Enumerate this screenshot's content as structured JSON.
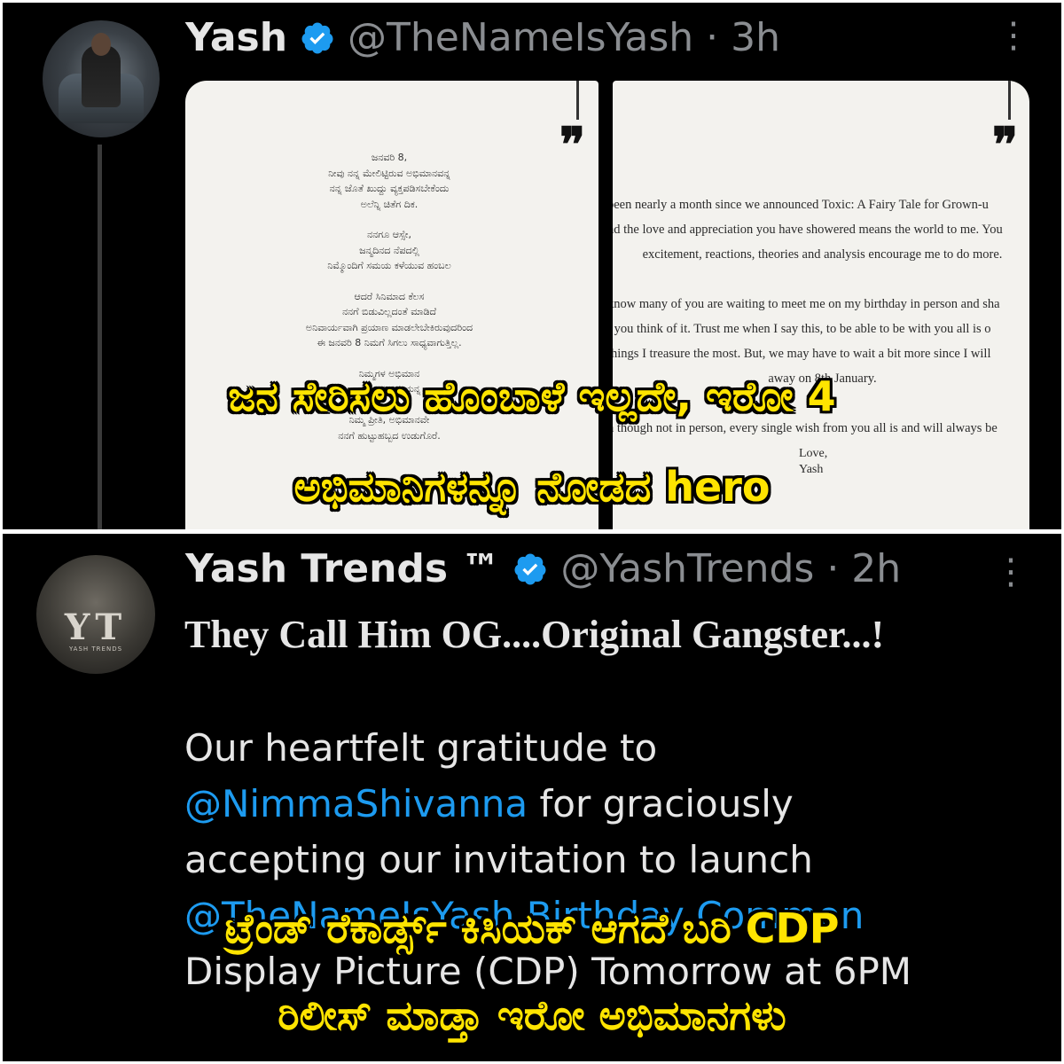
{
  "tweet1": {
    "name": "Yash",
    "handle": "@TheNameIsYash · 3h",
    "more": "⋮",
    "letter_left": [
      "ಜನವರಿ 8,",
      "ನೀವು ನನ್ನ ಮೇಲಿಟ್ಟಿರುವ ಅಭಿಮಾನವನ್ನ",
      "ನನ್ನ ಜೊತೆ ಖುದ್ದು ವ್ಯಕ್ತಪಡಿಸಬೇಕೆಂದು",
      "ಅಲೆನ್ನಿ ಚಿತೆಗ ದಿಕ.",
      "ನನಗೂ ಆಸ್ಸೇ,",
      "ಜನ್ಮದಿನದ ನೆಪದಲ್ಲಿ",
      "ನಿಮ್ಮೊಂದಿಗೆ ಸಮಯ ಕಳೆಯುವ ಹಂಬಲ",
      "ಆದರೆ ಸಿನಿಮಾದ ಕೆಲಸ",
      "ನನಗೆ ಬಿಡುವಿಲ್ಲದಂತೆ ಮಾಡಿದೆ",
      "ಅನಿವಾರ್ಯವಾಗಿ ಪ್ರಯಾಣ ಮಾಡಲೇಬೇಕಿರುವುದರಿಂದ",
      "ಈ ಜನವರಿ 8 ನಿಮಗೆ ಸಿಗಲು ಸಾಧ್ಯವಾಗುತ್ತಿಲ್ಲ.",
      "ನಿಮ್ಮಗಳ ಅಭಿಮಾನ",
      "ನನ್ನ ಅನುಮತ್ತಿಯನ್ನ",
      "ನಿಮ್ಮ ಪ್ರೀತಿ, ಅಭಿಮಾನವೇ",
      "ನನಗೆ ಹುಟ್ಟುಹಬ್ಬದ ಉಡುಗೊರೆ."
    ],
    "letter_right": [
      "been nearly a month since we announced Toxic: A Fairy Tale for Grown-u",
      "nd the love and appreciation you have showered means the world to me. You",
      "excitement, reactions, theories and analysis encourage me to do more.",
      "know many of you are waiting to meet me on my birthday in person and sha",
      "t you think of it. Trust me when I say this, to be able to be with you all is o",
      "things I treasure the most. But, we may have to wait a bit more since I will",
      "away on 8th January.",
      "n though not in person, every single wish from you all is and will always be",
      "Love,",
      "Yash"
    ]
  },
  "overlay_top": {
    "line1": "ಜನ ಸೇರಿಸಲು ಹೊಂಬಾಳೆ ಇಲ್ಲದೇ, ಇರೋ 4",
    "line2": "ಅಭಿಮಾನಿಗಳನ್ನೂ ನೋಡದ hero"
  },
  "tweet2": {
    "name": "Yash Trends ™",
    "handle": "@YashTrends · 2h",
    "more": "⋮",
    "avatar_logo": "YT",
    "avatar_sub": "YASH TRENDS",
    "title": "They Call Him OG....Original Gangster...!",
    "body_line1": "Our heartfelt gratitude to",
    "mention": "@NimmaShivanna",
    "body_line2_rest": " for graciously",
    "body_line3": "accepting our invitation to launch",
    "body_line4": "@TheNameIsYash Birthday Common",
    "body_line5": "Display Picture (CDP) Tomorrow at 6PM"
  },
  "overlay_bottom": {
    "line1": "ಟ್ರೆಂಡ್ ರೆಕಾರ್ಡ್ಸ್ ಕಿಸಿಯಕ್ ಆಗದೆ ಬರಿ CDP",
    "line2": "ರಿಲೀಸ್ ಮಾಡ್ತಾ ಇರೋ ಅಭಿಮಾನಗಳು"
  },
  "colors": {
    "background": "#000000",
    "text": "#e6e6e6",
    "muted": "#8a8d91",
    "verified": "#1d9bf0",
    "mention": "#1d9bf0",
    "overlay_text": "#ffe400"
  }
}
